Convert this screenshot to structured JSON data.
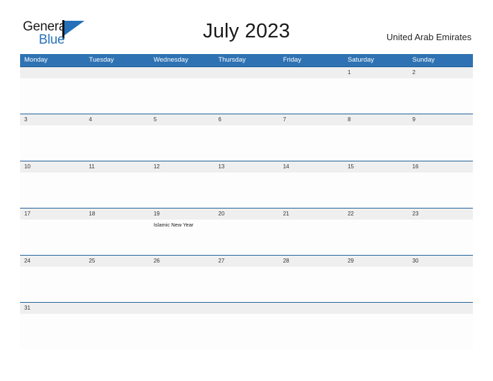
{
  "logo": {
    "word_one": "General",
    "word_two": "Blue",
    "mark": "flag-triangle",
    "color_dark": "#1a1a1a",
    "color_blue": "#2570b8"
  },
  "header": {
    "title": "July 2023",
    "region": "United Arab Emirates"
  },
  "theme": {
    "header_blue": "#2e72b3",
    "rule_blue": "#1f6099",
    "date_band": "#efefef",
    "cell_bg": "#fdfdfd"
  },
  "calendar": {
    "month": "July",
    "year": "2023",
    "weekday_headers": [
      "Monday",
      "Tuesday",
      "Wednesday",
      "Thursday",
      "Friday",
      "Saturday",
      "Sunday"
    ],
    "weeks": [
      {
        "days": [
          {
            "date": "",
            "event": ""
          },
          {
            "date": "",
            "event": ""
          },
          {
            "date": "",
            "event": ""
          },
          {
            "date": "",
            "event": ""
          },
          {
            "date": "",
            "event": ""
          },
          {
            "date": "1",
            "event": ""
          },
          {
            "date": "2",
            "event": ""
          }
        ]
      },
      {
        "days": [
          {
            "date": "3",
            "event": ""
          },
          {
            "date": "4",
            "event": ""
          },
          {
            "date": "5",
            "event": ""
          },
          {
            "date": "6",
            "event": ""
          },
          {
            "date": "7",
            "event": ""
          },
          {
            "date": "8",
            "event": ""
          },
          {
            "date": "9",
            "event": ""
          }
        ]
      },
      {
        "days": [
          {
            "date": "10",
            "event": ""
          },
          {
            "date": "11",
            "event": ""
          },
          {
            "date": "12",
            "event": ""
          },
          {
            "date": "13",
            "event": ""
          },
          {
            "date": "14",
            "event": ""
          },
          {
            "date": "15",
            "event": ""
          },
          {
            "date": "16",
            "event": ""
          }
        ]
      },
      {
        "days": [
          {
            "date": "17",
            "event": ""
          },
          {
            "date": "18",
            "event": ""
          },
          {
            "date": "19",
            "event": "Islamic New Year"
          },
          {
            "date": "20",
            "event": ""
          },
          {
            "date": "21",
            "event": ""
          },
          {
            "date": "22",
            "event": ""
          },
          {
            "date": "23",
            "event": ""
          }
        ]
      },
      {
        "days": [
          {
            "date": "24",
            "event": ""
          },
          {
            "date": "25",
            "event": ""
          },
          {
            "date": "26",
            "event": ""
          },
          {
            "date": "27",
            "event": ""
          },
          {
            "date": "28",
            "event": ""
          },
          {
            "date": "29",
            "event": ""
          },
          {
            "date": "30",
            "event": ""
          }
        ]
      },
      {
        "days": [
          {
            "date": "31",
            "event": ""
          },
          {
            "date": "",
            "event": ""
          },
          {
            "date": "",
            "event": ""
          },
          {
            "date": "",
            "event": ""
          },
          {
            "date": "",
            "event": ""
          },
          {
            "date": "",
            "event": ""
          },
          {
            "date": "",
            "event": ""
          }
        ]
      }
    ]
  }
}
